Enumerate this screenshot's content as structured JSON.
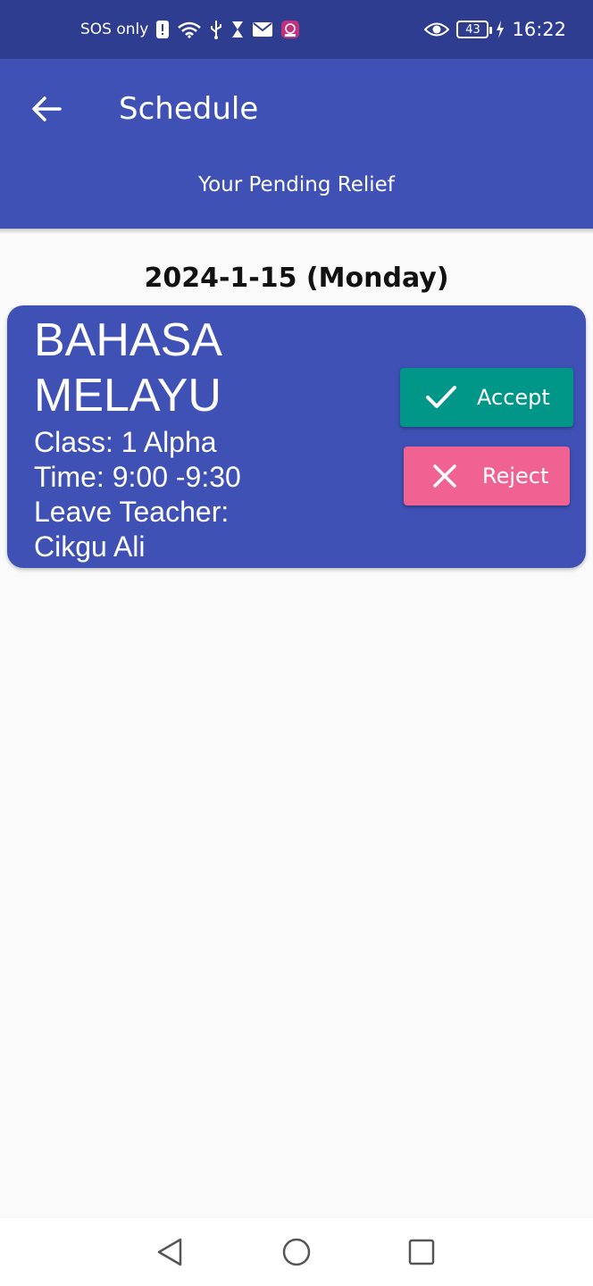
{
  "status_bar": {
    "carrier": "SOS only",
    "battery": "43",
    "time": "16:22",
    "icons": [
      "alert-icon",
      "wifi-icon",
      "usb-icon",
      "hourglass-icon",
      "mail-icon",
      "app-notification-icon",
      "eye-icon",
      "charging-icon"
    ]
  },
  "app_bar": {
    "title": "Schedule",
    "subtitle": "Your Pending Relief",
    "back_icon": "arrow-back-icon"
  },
  "date_heading": "2024-1-15 (Monday)",
  "relief_card": {
    "subject": "BAHASA MELAYU",
    "class_line": "Class: 1 Alpha",
    "time_line": "Time: 9:00 -9:30",
    "leave_label": "Leave Teacher:",
    "leave_teacher": "Cikgu Ali",
    "accept_label": "Accept",
    "reject_label": "Reject"
  },
  "colors": {
    "status_bar": "#2e3d8f",
    "primary": "#3f51b5",
    "accept": "#009688",
    "reject": "#f06292",
    "background": "#fafafa"
  },
  "nav_bar": {
    "icons": [
      "back-triangle-icon",
      "home-circle-icon",
      "recents-square-icon"
    ]
  }
}
